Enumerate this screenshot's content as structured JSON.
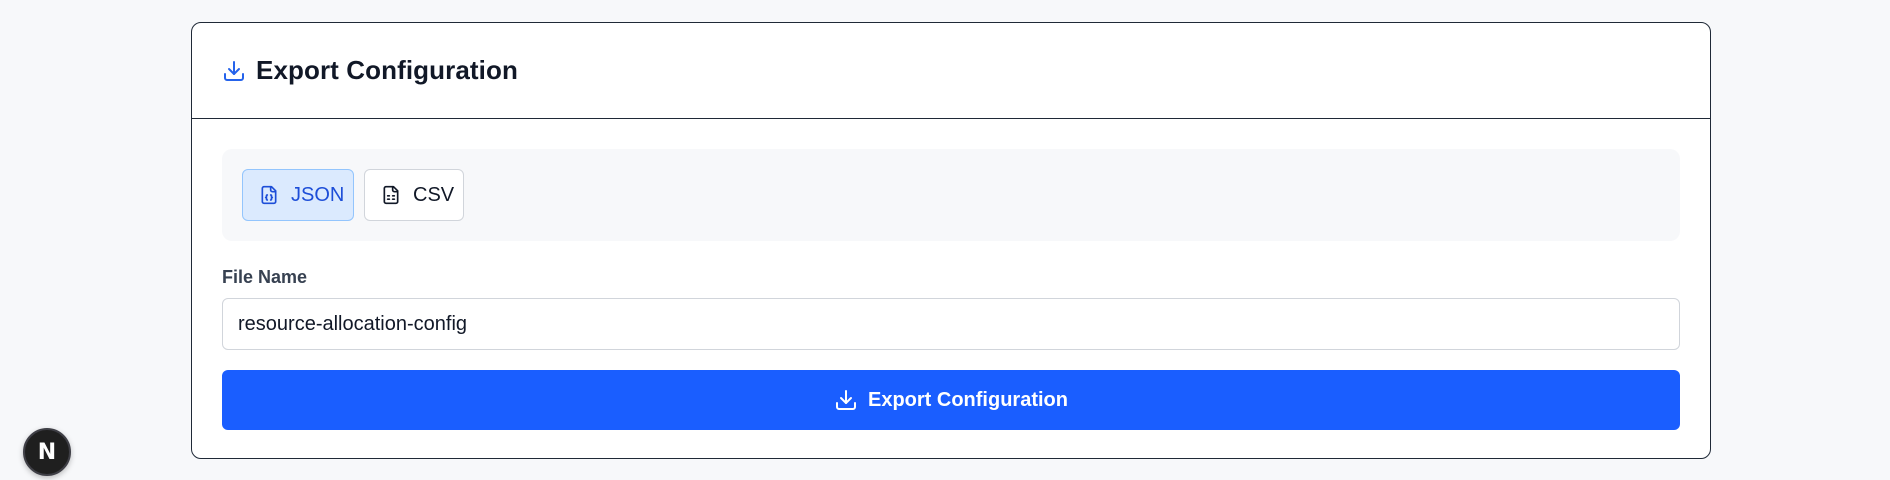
{
  "colors": {
    "accent": "#1a5eff",
    "active_bg": "#dbeafe",
    "active_text": "#1d4ed8",
    "page_bg": "#f7f8fa"
  },
  "card": {
    "title": "Export Configuration",
    "icon": "download-icon"
  },
  "formats": [
    {
      "label": "JSON",
      "icon": "file-json-icon",
      "selected": true
    },
    {
      "label": "CSV",
      "icon": "file-spreadsheet-icon",
      "selected": false
    }
  ],
  "file_name": {
    "label": "File Name",
    "value": "resource-allocation-config"
  },
  "export_button": {
    "label": "Export Configuration",
    "icon": "download-icon"
  },
  "dev_badge": {
    "letter": "N",
    "icon": "nextjs-logo-icon"
  }
}
